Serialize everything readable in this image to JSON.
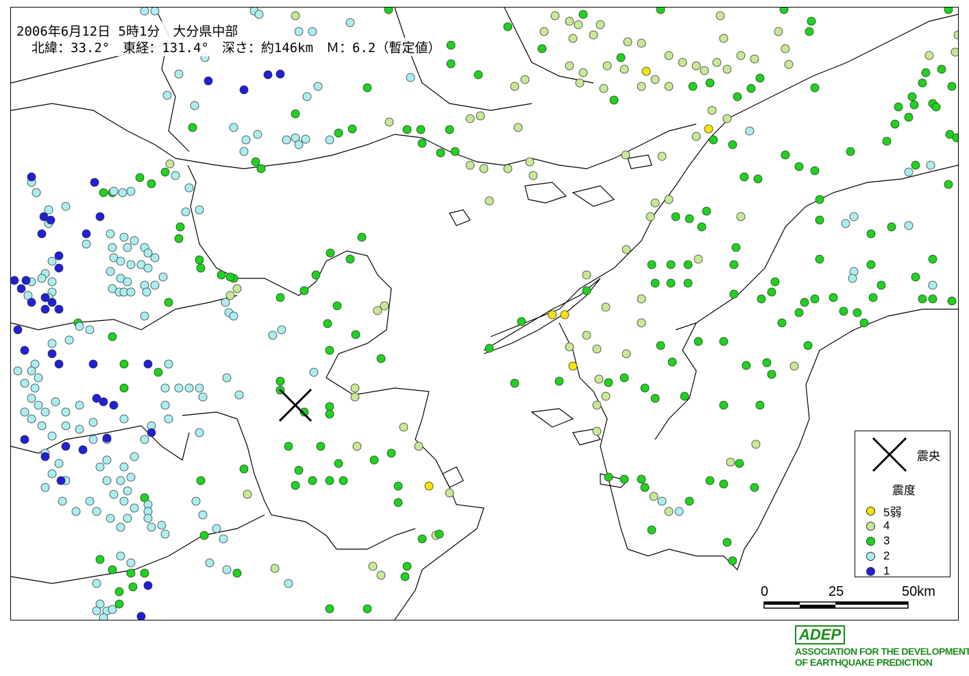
{
  "header": {
    "line1": "2006年6月12日 5時1分　大分県中部",
    "line2": "北緯：33.2°　東経：131.4°　深さ：約146km　Ｍ：6.2（暫定値）"
  },
  "legend": {
    "epicenter_label": "震央",
    "intensity_title": "震度",
    "items": [
      {
        "label": "5弱",
        "color": "#f5e400"
      },
      {
        "label": "4",
        "color": "#c8e896"
      },
      {
        "label": "3",
        "color": "#1ed21e"
      },
      {
        "label": "2",
        "color": "#aaeef0"
      },
      {
        "label": "1",
        "color": "#2020d8"
      }
    ]
  },
  "scale": {
    "ticks": [
      "0",
      "25",
      "50km"
    ]
  },
  "branding": {
    "logo": "ADEP",
    "line1": "ASSOCIATION FOR THE DEVELOPMENT",
    "line2": "OF EARTHQUAKE PREDICTION"
  },
  "colors": {
    "i5": "#f5e400",
    "i4": "#c8e896",
    "i3": "#1ed21e",
    "i2": "#aaeef0",
    "i1": "#2020d8"
  }
}
